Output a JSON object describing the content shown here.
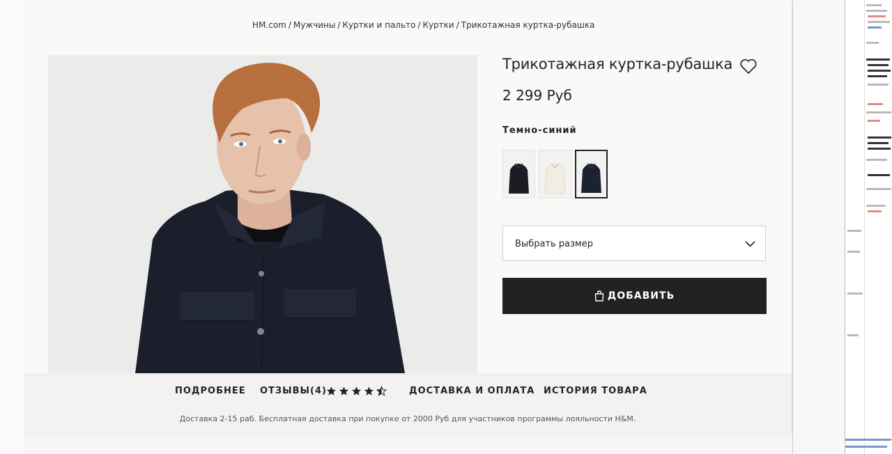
{
  "breadcrumb": {
    "items": [
      "HM.com",
      "Мужчины",
      "Куртки и пальто",
      "Куртки",
      "Трикотажная куртка-рубашка"
    ],
    "separator": "/"
  },
  "product": {
    "title": "Трикотажная куртка-рубашка",
    "price": "2 299 Руб",
    "color_label": "Темно-синий",
    "swatches": [
      {
        "name": "black",
        "color": "#1c1d22"
      },
      {
        "name": "white",
        "color": "#f1ede3"
      },
      {
        "name": "navy",
        "color": "#1d2233",
        "selected": true
      }
    ]
  },
  "size_select": {
    "placeholder": "Выбрать размер"
  },
  "add_button": {
    "label": "ДОБАВИТЬ"
  },
  "tabs": {
    "details": "ПОДРОБНЕЕ",
    "reviews": "ОТЗЫВЫ(4)",
    "delivery": "ДОСТАВКА И ОПЛАТА",
    "history": "ИСТОРИЯ ТОВАРА"
  },
  "rating": {
    "value": 4.5,
    "max": 5
  },
  "delivery_note": "Доставка 2-15 раб. Бесплатная доставка при покупке от 2000 Руб для участников программы лояльности H&M.",
  "colors": {
    "button_bg": "#222222",
    "page_bg": "#faf9f8",
    "photo_bg": "#ebebea"
  },
  "icons": {
    "favorite": "heart-outline-icon",
    "bag": "shopping-bag-icon",
    "dropdown": "chevron-down-icon"
  }
}
